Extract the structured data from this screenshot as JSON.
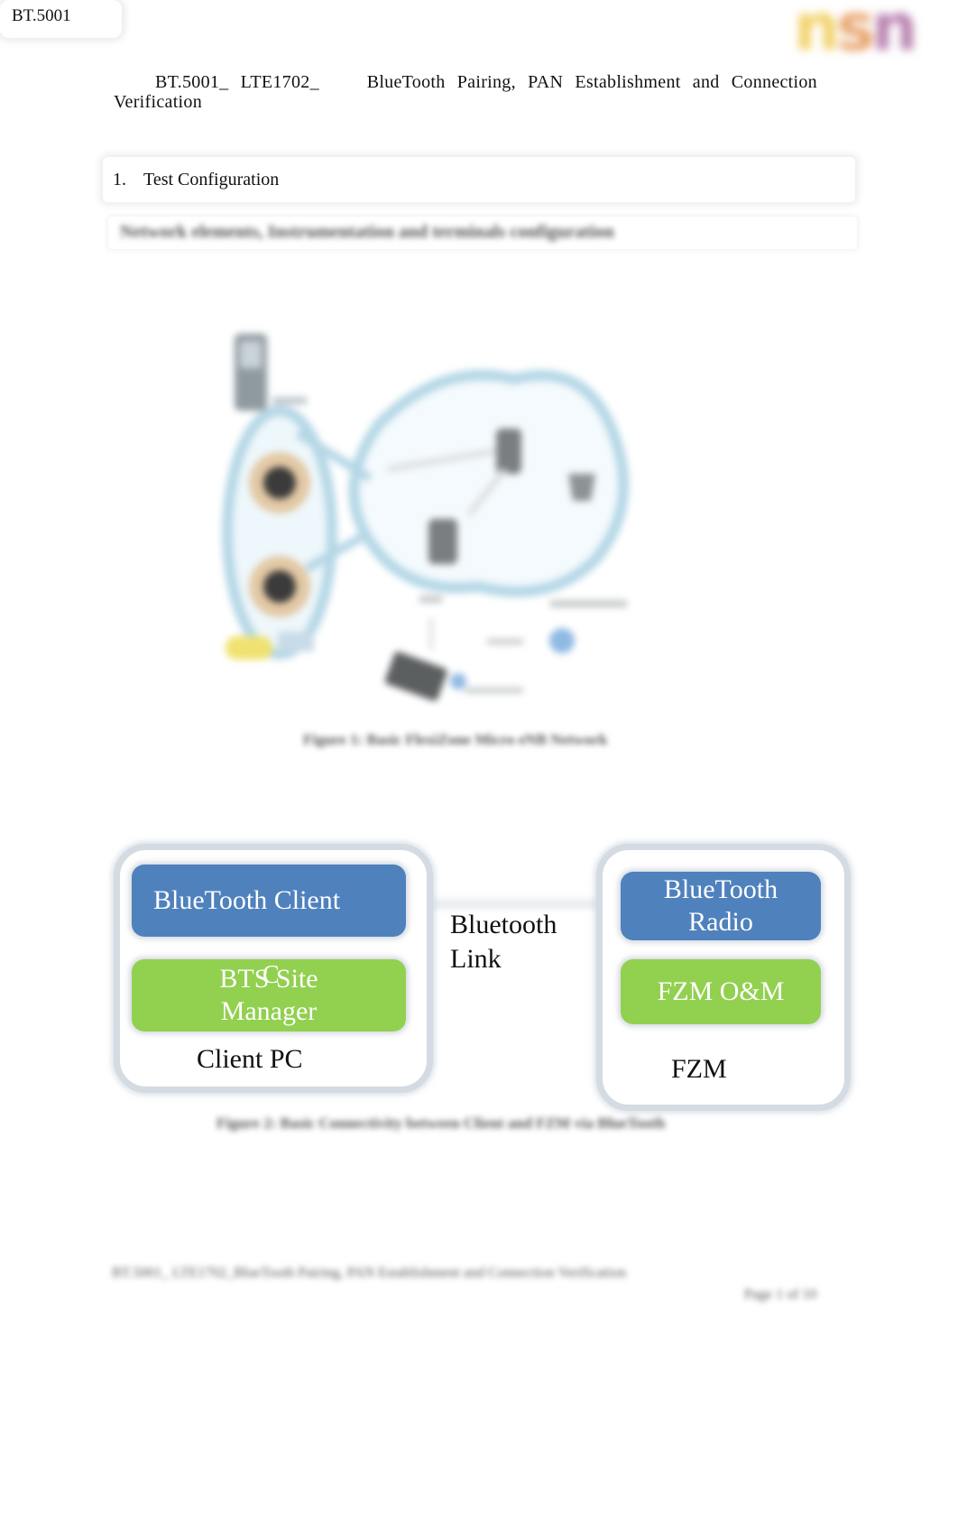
{
  "header": {
    "doc_id_tag": "BT.5001",
    "logo": {
      "text_parts": [
        "n",
        "s",
        "n"
      ],
      "colors": [
        "#f1d167",
        "#e7a067",
        "#b67fad"
      ]
    }
  },
  "title": {
    "prefix": "BT.5001_ LTE1702_",
    "text": "BlueTooth Pairing, PAN Establishment and Connection Verification"
  },
  "section": {
    "number": "1.",
    "heading": "Test Configuration",
    "subheading": "Network elements, Instrumentation and terminals configuration"
  },
  "figure1": {
    "description": "Network topology illustration (blurred)",
    "caption": "Figure 1: Basic FlexiZone Micro eNB Network"
  },
  "figure2": {
    "client_group": {
      "blocks": [
        "BlueTooth Client",
        "BTS Site Manager"
      ],
      "label": "Client PC"
    },
    "link_label_line1": "Bluetooth",
    "link_label_line2": "Link",
    "fzm_group": {
      "blocks": [
        "BlueTooth Radio",
        "FZM O&M"
      ],
      "label": "FZM"
    },
    "stray_glyph": "C",
    "colors": {
      "blue_block": "#4f81bd",
      "green_block": "#92d050",
      "group_border": "#d4dbe2"
    },
    "caption": "Figure 2: Basic Connectivity between Client and FZM via BlueTooth"
  },
  "footer": {
    "left_text": "BT.5001_ LTE1702_BlueTooth Pairing, PAN Establishment and Connection Verification",
    "page_label": "Page 1 of 10"
  }
}
